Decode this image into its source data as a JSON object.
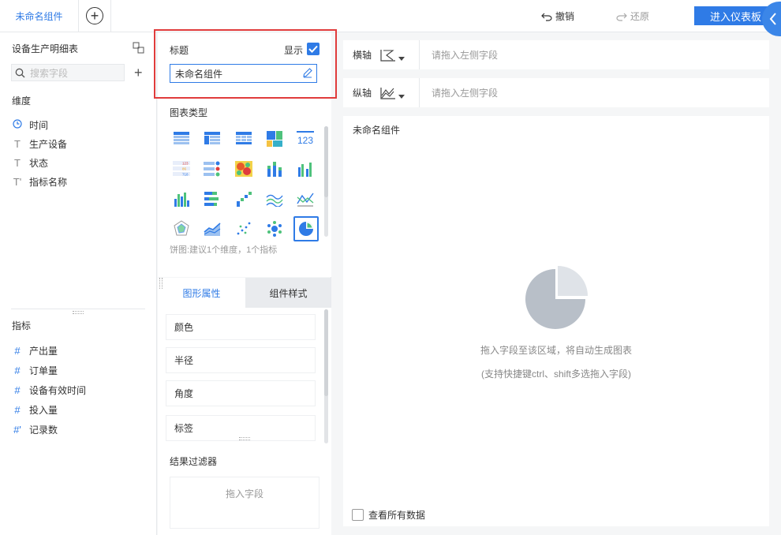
{
  "topbar": {
    "tab_label": "未命名组件",
    "undo_label": "撤销",
    "redo_label": "还原",
    "enter_dashboard_label": "进入仪表板"
  },
  "left": {
    "dataset_name": "设备生产明细表",
    "search_placeholder": "搜索字段",
    "dimensions_label": "维度",
    "dimensions": [
      {
        "icon": "clock-icon",
        "label": "时间"
      },
      {
        "icon": "text-field-icon",
        "label": "生产设备"
      },
      {
        "icon": "text-field-icon",
        "label": "状态"
      },
      {
        "icon": "text-calc-field-icon",
        "label": "指标名称"
      }
    ],
    "measures_label": "指标",
    "measures": [
      {
        "icon": "number-field-icon",
        "label": "产出量"
      },
      {
        "icon": "number-field-icon",
        "label": "订单量"
      },
      {
        "icon": "number-field-icon",
        "label": "设备有效时间"
      },
      {
        "icon": "number-field-icon",
        "label": "投入量"
      },
      {
        "icon": "number-calc-field-icon",
        "label": "记录数"
      }
    ]
  },
  "middle": {
    "title_label": "标题",
    "show_label": "显示",
    "show_checked": true,
    "component_name": "未命名组件",
    "chart_type_label": "图表类型",
    "chart_hint": "饼图:建议1个维度，1个指标",
    "tabs": [
      "图形属性",
      "组件样式"
    ],
    "properties": [
      "颜色",
      "半径",
      "角度",
      "标签"
    ],
    "filter_label": "结果过滤器",
    "filter_placeholder": "拖入字段"
  },
  "right": {
    "x_axis_label": "横轴",
    "y_axis_label": "纵轴",
    "axis_placeholder": "请拖入左侧字段",
    "canvas_title": "未命名组件",
    "hint_line1": "拖入字段至该区域，将自动生成图表",
    "hint_line2": "(支持快捷键ctrl、shift多选拖入字段)",
    "view_all_label": "查看所有数据"
  },
  "colors": {
    "accent": "#2f7be6",
    "highlight_border": "#e03c3c",
    "placeholder_pie": "#b8bfc8"
  }
}
